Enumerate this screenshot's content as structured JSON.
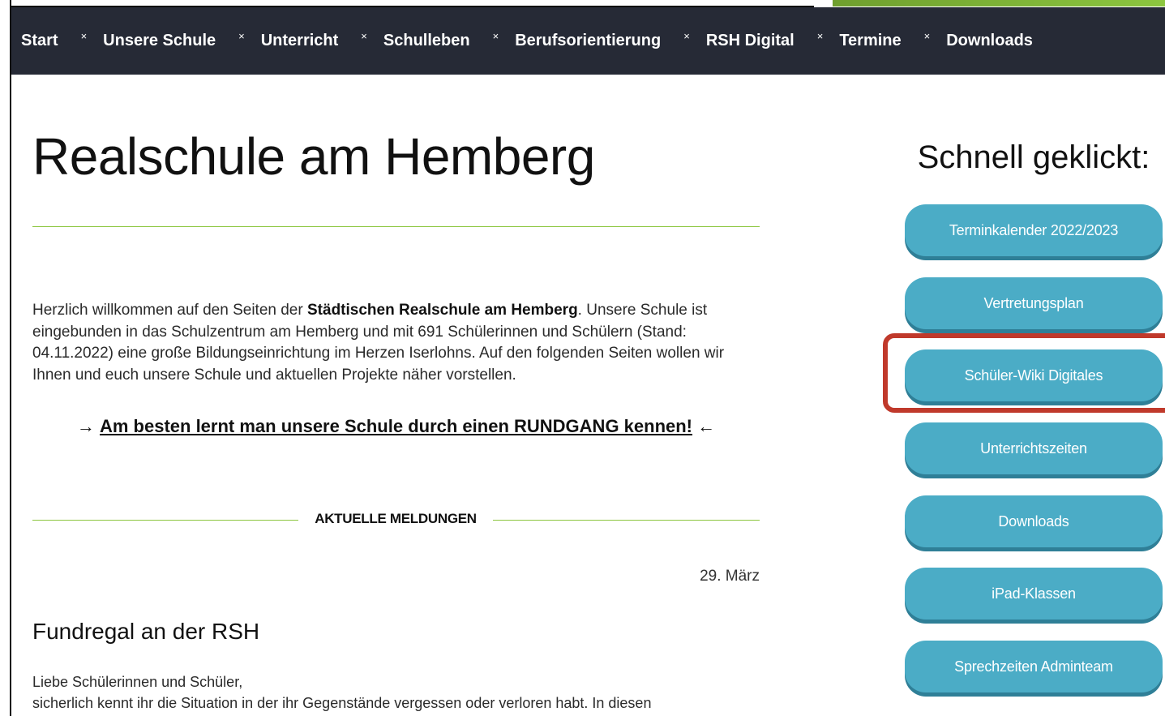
{
  "nav": {
    "items": [
      "Start",
      "Unsere Schule",
      "Unterricht",
      "Schulleben",
      "Berufsorientierung",
      "RSH Digital",
      "Termine",
      "Downloads"
    ],
    "separator": "×"
  },
  "main": {
    "title": "Realschule am Hemberg",
    "intro_prefix": "Herzlich willkommen auf den Seiten der ",
    "intro_bold": "Städtischen Realschule am Hemberg",
    "intro_suffix": ". Unsere Schule ist eingebunden in das Schulzentrum am Hemberg und mit 691 Schülerinnen und Schülern (Stand: 04.11.2022) eine große Bildungseinrichtung im Herzen Iserlohns. Auf den folgenden Seiten wollen wir Ihnen und euch unsere Schule und aktuellen Projekte näher vorstellen.",
    "tour_arrow_left": "→",
    "tour_link": "Am besten lernt man unsere Schule durch einen RUNDGANG kennen!",
    "tour_arrow_right": "←",
    "news_heading": "AKTUELLE MELDUNGEN",
    "news_date": "29. März",
    "post_title": "Fundregal an der RSH",
    "post_greeting": "Liebe Schülerinnen und Schüler,",
    "post_line": "sicherlich kennt ihr die Situation in der ihr Gegenstände vergessen oder verloren habt. In diesen"
  },
  "sidebar": {
    "title": "Schnell geklickt:",
    "buttons": [
      "Terminkalender 2022/2023",
      "Vertretungsplan",
      "Schüler-Wiki Digitales",
      "Unterrichtszeiten",
      "Downloads",
      "iPad-Klassen",
      "Sprechzeiten Adminteam"
    ]
  },
  "colors": {
    "nav_bg": "#262a36",
    "accent_green": "#8cc63f",
    "button_blue": "#4bacc6",
    "highlight_red": "#c0392b"
  }
}
